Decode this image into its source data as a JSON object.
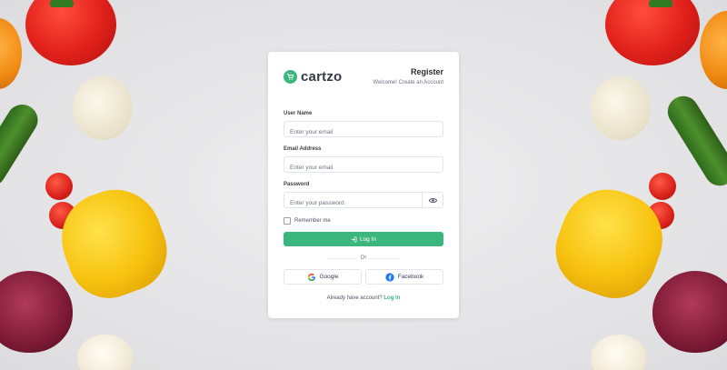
{
  "brand": {
    "name": "cartzo",
    "accent_color": "#3bb77e"
  },
  "header": {
    "title": "Register",
    "subtitle": "Welcome! Create an Account"
  },
  "form": {
    "username": {
      "label": "User Name",
      "placeholder": "Enter your email"
    },
    "email": {
      "label": "Email Address",
      "placeholder": "Enter your email"
    },
    "password": {
      "label": "Password",
      "placeholder": "Enter your password",
      "toggle_icon": "eye-icon"
    },
    "remember_label": "Remember me",
    "submit_label": "Log In",
    "submit_icon": "login-icon"
  },
  "divider": {
    "text": "Or"
  },
  "social": {
    "google_label": "Google",
    "facebook_label": "Facebook"
  },
  "footer": {
    "prompt": "Already have account?",
    "link_label": "Log In"
  }
}
